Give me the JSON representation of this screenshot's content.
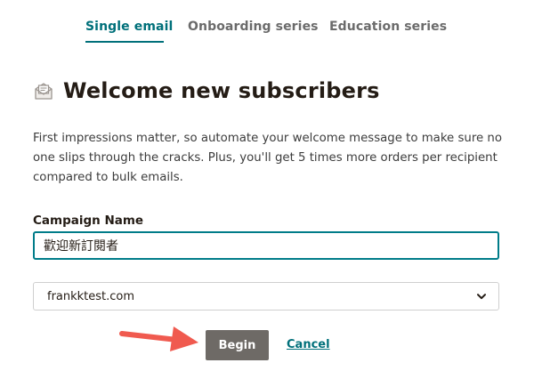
{
  "tabs": [
    {
      "label": "Single email",
      "active": true
    },
    {
      "label": "Onboarding series",
      "active": false
    },
    {
      "label": "Education series",
      "active": false
    }
  ],
  "header": {
    "icon": "envelope-icon",
    "title": "Welcome new subscribers"
  },
  "description": "First impressions matter, so automate your welcome message to make sure no one slips through the cracks. Plus, you'll get 5 times more orders per recipient compared to bulk emails.",
  "form": {
    "campaign_name_label": "Campaign Name",
    "campaign_name_value": "歡迎新訂閱者",
    "domain_value": "frankktest.com",
    "domain_icon": "chevron-down-icon"
  },
  "actions": {
    "begin_label": "Begin",
    "cancel_label": "Cancel"
  },
  "annotation": {
    "icon": "pointer-arrow-icon",
    "color": "#f05a4f"
  },
  "colors": {
    "accent": "#00707a",
    "button": "#6e6a66",
    "text": "#241c15"
  }
}
